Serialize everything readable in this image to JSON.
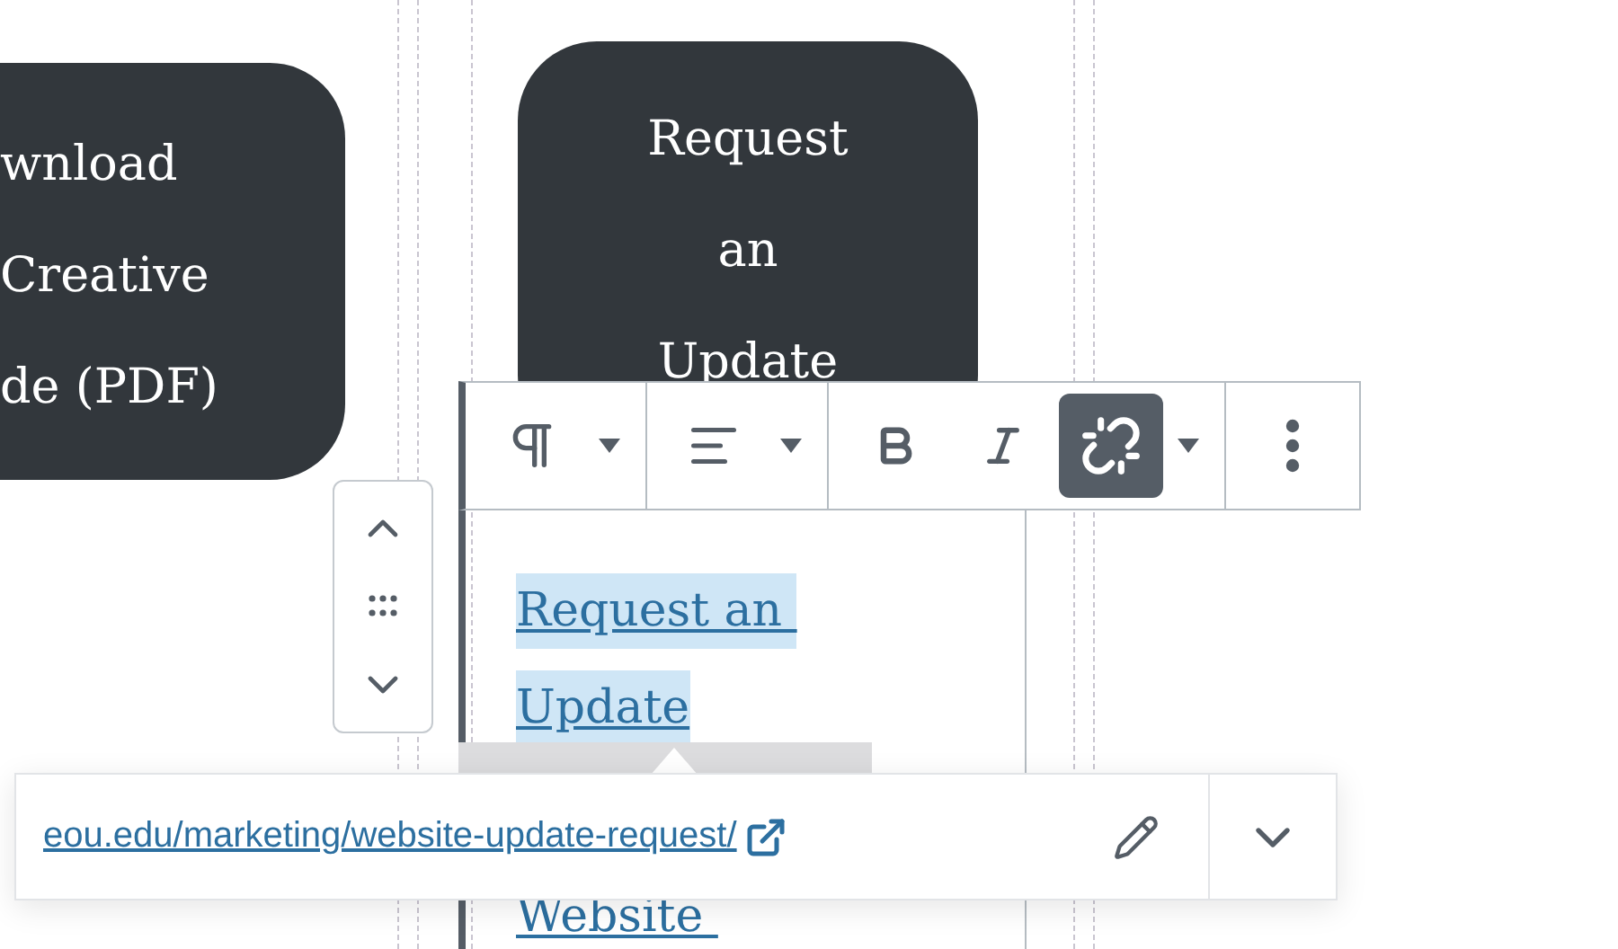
{
  "left_button": {
    "lines": [
      "wnload",
      "Creative",
      "de (PDF)"
    ]
  },
  "right_button": {
    "lines": [
      "Request",
      "an",
      "Update"
    ]
  },
  "toolbar": {
    "groups": [
      {
        "items": [
          {
            "kind": "paragraph",
            "selected": false
          },
          {
            "kind": "caret",
            "selected": false
          }
        ]
      },
      {
        "items": [
          {
            "kind": "align",
            "selected": false
          },
          {
            "kind": "caret",
            "selected": false
          }
        ]
      },
      {
        "items": [
          {
            "kind": "bold",
            "selected": false
          },
          {
            "kind": "italic",
            "selected": false
          },
          {
            "kind": "link",
            "selected": true
          },
          {
            "kind": "caret",
            "selected": false
          }
        ]
      },
      {
        "items": [
          {
            "kind": "more",
            "selected": false
          }
        ]
      }
    ]
  },
  "paragraph": {
    "lines": [
      {
        "text": "Request an ",
        "selected": true
      },
      {
        "text": "Update",
        "selected": true
      },
      {
        "text": "Website ",
        "selected": false
      }
    ]
  },
  "link_popover": {
    "url": "eou.edu/marketing/website-update-request/"
  }
}
